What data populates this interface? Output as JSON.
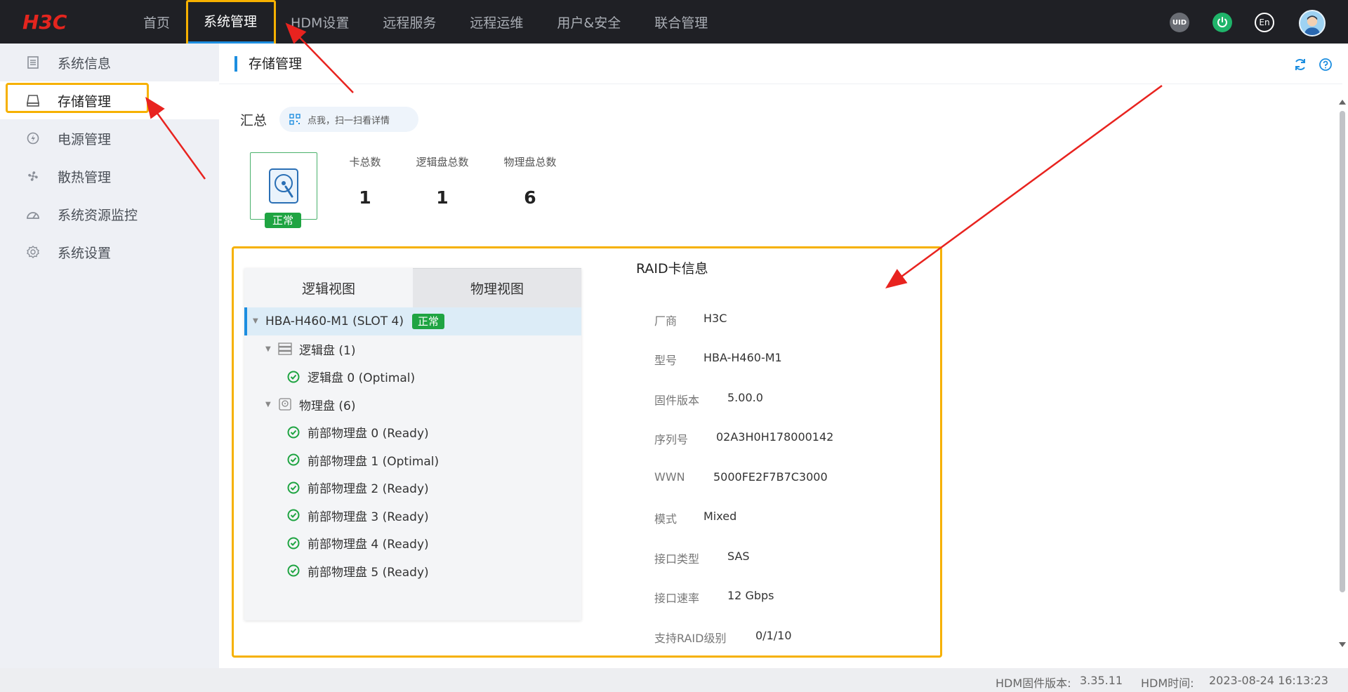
{
  "brand": {
    "logo_text": "H3C"
  },
  "nav": {
    "items": [
      "首页",
      "系统管理",
      "HDM设置",
      "远程服务",
      "远程运维",
      "用户&安全",
      "联合管理"
    ]
  },
  "top_icons": {
    "uid_label": "UID",
    "lang_label": "En"
  },
  "sidebar": {
    "items": [
      {
        "label": "系统信息",
        "icon": "document-icon"
      },
      {
        "label": "存储管理",
        "icon": "drive-icon"
      },
      {
        "label": "电源管理",
        "icon": "power-icon"
      },
      {
        "label": "散热管理",
        "icon": "fan-icon"
      },
      {
        "label": "系统资源监控",
        "icon": "gauge-icon"
      },
      {
        "label": "系统设置",
        "icon": "gear-icon"
      }
    ]
  },
  "page": {
    "title": "存储管理"
  },
  "summary": {
    "label": "汇总",
    "qr_text": "点我，扫一扫看详情",
    "status_badge": "正常",
    "stats": [
      {
        "label": "卡总数",
        "value": "1"
      },
      {
        "label": "逻辑盘总数",
        "value": "1"
      },
      {
        "label": "物理盘总数",
        "value": "6"
      }
    ]
  },
  "tabs": {
    "logical": "逻辑视图",
    "physical": "物理视图"
  },
  "tree": {
    "card": {
      "label": "HBA-H460-M1 (SLOT 4)",
      "badge": "正常"
    },
    "logical_group": "逻辑盘 (1)",
    "logical_items": [
      "逻辑盘 0 (Optimal)"
    ],
    "physical_group": "物理盘 (6)",
    "physical_items": [
      "前部物理盘 0 (Ready)",
      "前部物理盘 1 (Optimal)",
      "前部物理盘 2 (Ready)",
      "前部物理盘 3 (Ready)",
      "前部物理盘 4 (Ready)",
      "前部物理盘 5 (Ready)"
    ]
  },
  "raid_info": {
    "title": "RAID卡信息",
    "fields": [
      {
        "key": "厂商",
        "value": "H3C"
      },
      {
        "key": "型号",
        "value": "HBA-H460-M1"
      },
      {
        "key": "固件版本",
        "value": "5.00.0"
      },
      {
        "key": "序列号",
        "value": "02A3H0H178000142"
      },
      {
        "key": "WWN",
        "value": "5000FE2F7B7C3000"
      },
      {
        "key": "模式",
        "value": "Mixed"
      },
      {
        "key": "接口类型",
        "value": "SAS"
      },
      {
        "key": "接口速率",
        "value": "12 Gbps"
      },
      {
        "key": "支持RAID级别",
        "value": "0/1/10"
      }
    ]
  },
  "footer": {
    "fw_label": "HDM固件版本:",
    "fw_value": "3.35.11",
    "time_label": "HDM时间:",
    "time_value": "2023-08-24 16:13:23"
  },
  "colors": {
    "accent": "#1d8ee0",
    "ok": "#1fa442",
    "highlight": "#f6b100",
    "annotation": "#e8231f"
  }
}
